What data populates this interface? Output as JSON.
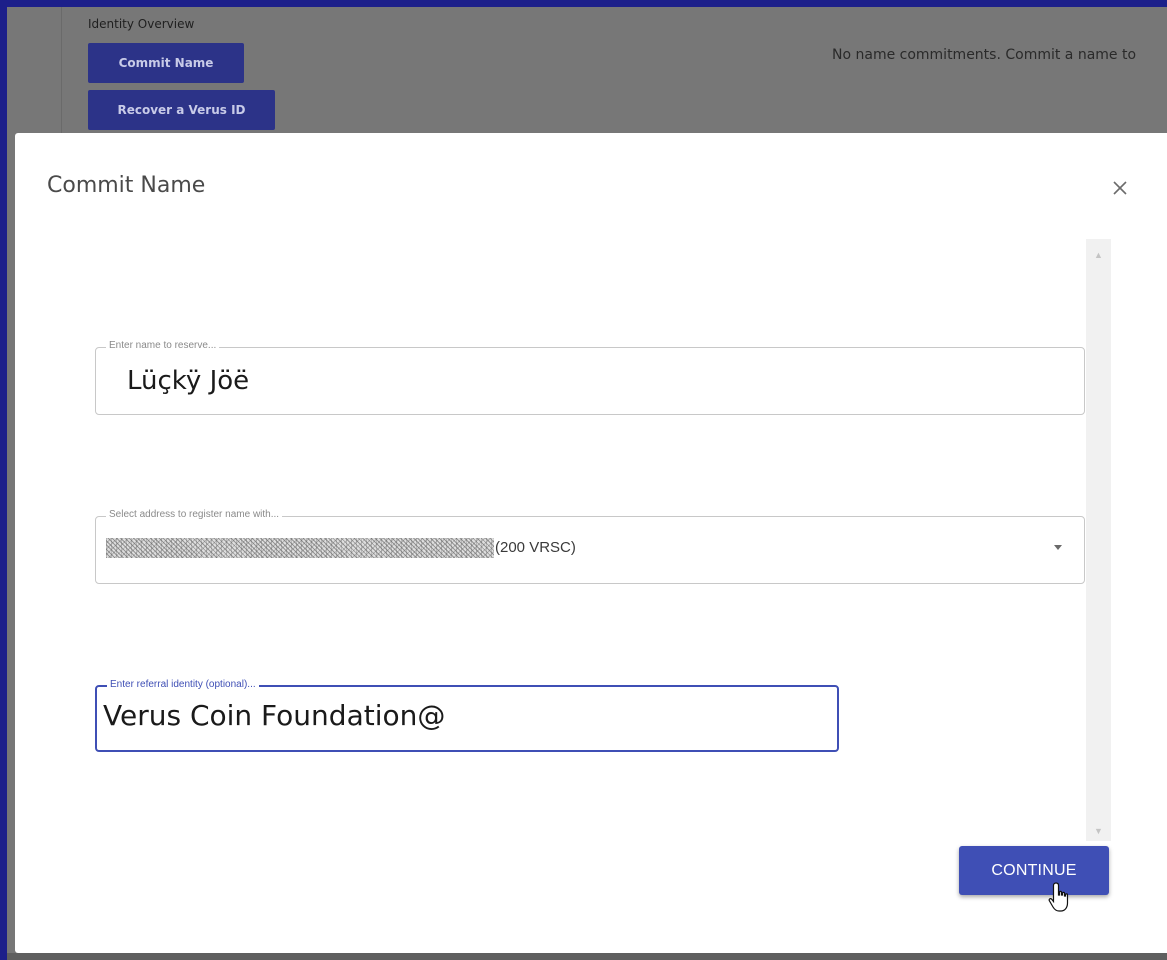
{
  "background": {
    "section_title": "Identity Overview",
    "commit_button_label": "Commit Name",
    "recover_button_label": "Recover a Verus ID",
    "empty_message": "No name commitments. Commit a name to"
  },
  "dialog": {
    "title": "Commit Name",
    "close_icon": "close-icon",
    "name_field": {
      "label": "Enter name to reserve...",
      "value": "Lüçkÿ Jöë"
    },
    "address_field": {
      "label": "Select address to register name with...",
      "selected_suffix": "(200 VRSC)"
    },
    "referral_field": {
      "label": "Enter referral identity (optional)...",
      "value": "Verus Coin Foundation@"
    },
    "continue_label": "CONTINUE"
  },
  "colors": {
    "primary": "#3f4fb5",
    "window_border": "#1c1f8a",
    "overlay": "#777777"
  }
}
